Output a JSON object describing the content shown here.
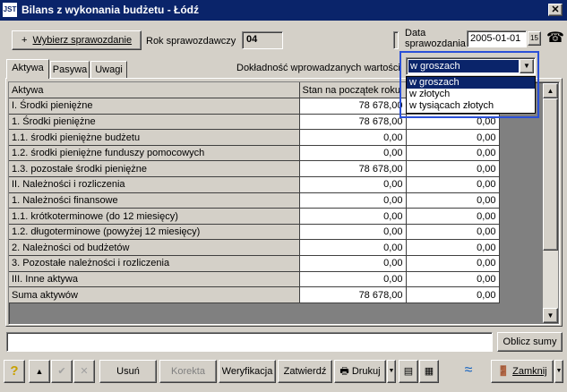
{
  "window": {
    "title": "Bilans z wykonania budżetu - Łódź",
    "icon_text": "JST"
  },
  "toolbar": {
    "choose_report": "Wybierz sprawozdanie",
    "year_label": "Rok sprawozdawczy",
    "year_value": "04",
    "date_label_1": "Data",
    "date_label_2": "sprawozdania",
    "date_value": "2005-01-01",
    "calendar_label": "15"
  },
  "tabs": [
    "Aktywa",
    "Pasywa",
    "Uwagi"
  ],
  "precision": {
    "label": "Dokładność wprowadzanych wartości",
    "selected": "w groszach",
    "options": [
      "w groszach",
      "w złotych",
      "w tysiącach złotych"
    ]
  },
  "table": {
    "headers": [
      "Aktywa",
      "Stan na początek roku",
      ""
    ],
    "rows": [
      [
        "I. Środki pieniężne",
        "78 678,00",
        "0,00"
      ],
      [
        "1. Środki pieniężne",
        "78 678,00",
        "0,00"
      ],
      [
        "1.1. środki pieniężne budżetu",
        "0,00",
        "0,00"
      ],
      [
        "1.2. środki pieniężne funduszy pomocowych",
        "0,00",
        "0,00"
      ],
      [
        "1.3. pozostałe środki pieniężne",
        "78 678,00",
        "0,00"
      ],
      [
        "II. Należności i rozliczenia",
        "0,00",
        "0,00"
      ],
      [
        "1. Należności finansowe",
        "0,00",
        "0,00"
      ],
      [
        "1.1. krótkoterminowe (do 12 miesięcy)",
        "0,00",
        "0,00"
      ],
      [
        "1.2. długoterminowe (powyżej 12 miesięcy)",
        "0,00",
        "0,00"
      ],
      [
        "2. Należności od budżetów",
        "0,00",
        "0,00"
      ],
      [
        "3. Pozostałe należności i rozliczenia",
        "0,00",
        "0,00"
      ],
      [
        "III. Inne aktywa",
        "0,00",
        "0,00"
      ],
      [
        "Suma aktywów",
        "78 678,00",
        "0,00"
      ]
    ]
  },
  "bottom": {
    "sum_button": "Oblicz sumy",
    "delete": "Usuń",
    "correct": "Korekta",
    "verify": "Weryfikacja",
    "approve": "Zatwierdź",
    "print": "Drukuj",
    "close": "Zamknij"
  },
  "colors": {
    "title_bg": "#0a246a",
    "dropdown_border": "#2a50d8",
    "face": "#d4d0c8"
  }
}
